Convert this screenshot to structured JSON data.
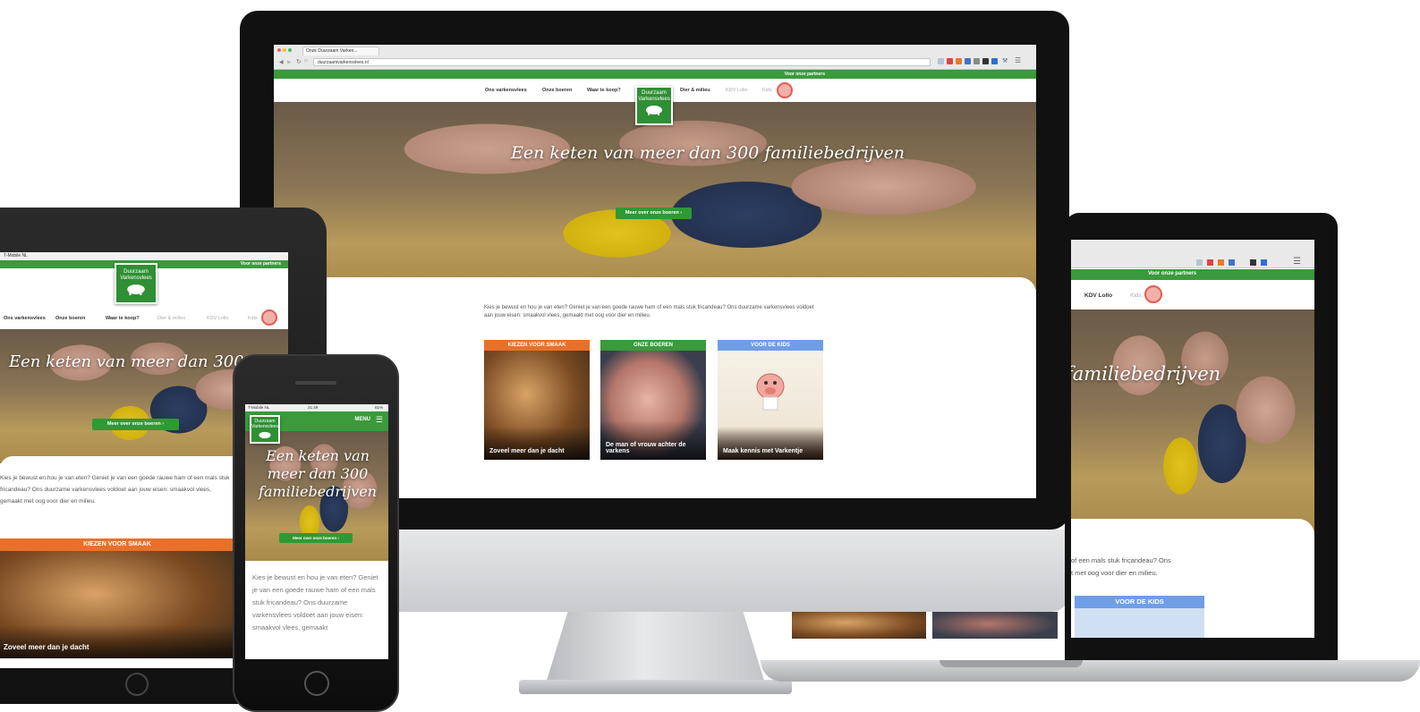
{
  "browser": {
    "tab_title": "Onze Duurzaam Varken...",
    "address": "duurzaamvarkensvlees.nl"
  },
  "topbar": {
    "partner_link": "Voor onze partners"
  },
  "nav": {
    "items": [
      "Ons varkensvlees",
      "Onze boeren",
      "Waar te koop?",
      "Dier & milieu",
      "KDV Lollo",
      "Kids"
    ],
    "logo_text": "Duurzaam Varkensvlees"
  },
  "hero": {
    "headline": "Een keten van meer dan 300 familiebedrijven",
    "cta": "Meer over onze boeren"
  },
  "intro": "Kies je bewust en hou je van eten? Geniet je van een goede rauwe ham of een mals stuk fricandeau? Ons duurzame varkensvlees voldoet aan jouw eisen: smaakvol vlees, gemaakt met oog voor dier en milieu.",
  "tiles": [
    {
      "caption": "KIEZEN VOOR SMAAK",
      "title": "Zoveel meer dan je dacht",
      "color": "#e8712a"
    },
    {
      "caption": "ONZE BOEREN",
      "title": "De man of vrouw achter de varkens",
      "color": "#3a9a3c"
    },
    {
      "caption": "VOOR DE KIDS",
      "title": "Maak kennis met Varkentje",
      "color": "#6f9ee6"
    }
  ],
  "laptop": {
    "hero_fragment": "familiebedrijven",
    "intro_line1": "of een mals stuk fricandeau? Ons",
    "intro_line2": "t met oog voor dier en milieu.",
    "kids_caption": "VOOR DE KIDS"
  },
  "tablet": {
    "status": "T-Mobile NL",
    "hero_headline": "Een keten van meer dan 300 familiebedrijven",
    "intro": "Kies je bewust en hou je van eten? Geniet je van een goede rauwe ham of een mals stuk fricandeau? Ons duurzame varkensvlees voldoet aan jouw eisen: smaakvol vlees, gemaakt met oog voor dier en milieu.",
    "tile_caption": "KIEZEN VOOR SMAAK",
    "tile_title": "Zoveel meer dan je dacht"
  },
  "phone": {
    "status": "T-Mobile NL",
    "time": "21:49",
    "battery": "61%",
    "menu": "MENU",
    "hero_headline": "Een keten van meer dan 300 familiebedrijven",
    "cta": "Meer over onze boeren",
    "intro": "Kies je bewust en hou je van eten? Geniet je van een goede rauwe ham of een mals stuk fricandeau? Ons duurzame varkensvlees voldoet aan jouw eisen: smaakvol vlees, gemaakt"
  }
}
